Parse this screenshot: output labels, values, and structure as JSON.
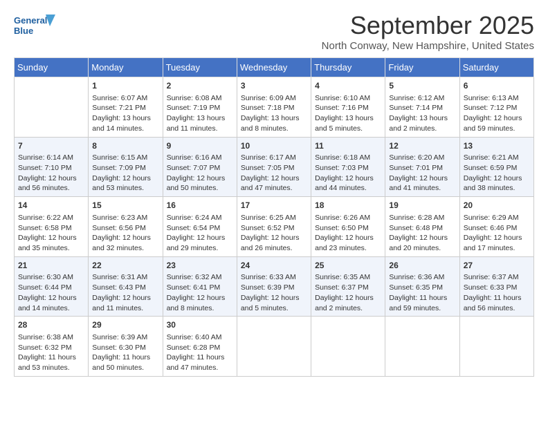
{
  "header": {
    "logo_line1": "General",
    "logo_line2": "Blue",
    "title": "September 2025",
    "subtitle": "North Conway, New Hampshire, United States"
  },
  "days_of_week": [
    "Sunday",
    "Monday",
    "Tuesday",
    "Wednesday",
    "Thursday",
    "Friday",
    "Saturday"
  ],
  "weeks": [
    [
      {
        "day": "",
        "info": ""
      },
      {
        "day": "1",
        "info": "Sunrise: 6:07 AM\nSunset: 7:21 PM\nDaylight: 13 hours\nand 14 minutes."
      },
      {
        "day": "2",
        "info": "Sunrise: 6:08 AM\nSunset: 7:19 PM\nDaylight: 13 hours\nand 11 minutes."
      },
      {
        "day": "3",
        "info": "Sunrise: 6:09 AM\nSunset: 7:18 PM\nDaylight: 13 hours\nand 8 minutes."
      },
      {
        "day": "4",
        "info": "Sunrise: 6:10 AM\nSunset: 7:16 PM\nDaylight: 13 hours\nand 5 minutes."
      },
      {
        "day": "5",
        "info": "Sunrise: 6:12 AM\nSunset: 7:14 PM\nDaylight: 13 hours\nand 2 minutes."
      },
      {
        "day": "6",
        "info": "Sunrise: 6:13 AM\nSunset: 7:12 PM\nDaylight: 12 hours\nand 59 minutes."
      }
    ],
    [
      {
        "day": "7",
        "info": "Sunrise: 6:14 AM\nSunset: 7:10 PM\nDaylight: 12 hours\nand 56 minutes."
      },
      {
        "day": "8",
        "info": "Sunrise: 6:15 AM\nSunset: 7:09 PM\nDaylight: 12 hours\nand 53 minutes."
      },
      {
        "day": "9",
        "info": "Sunrise: 6:16 AM\nSunset: 7:07 PM\nDaylight: 12 hours\nand 50 minutes."
      },
      {
        "day": "10",
        "info": "Sunrise: 6:17 AM\nSunset: 7:05 PM\nDaylight: 12 hours\nand 47 minutes."
      },
      {
        "day": "11",
        "info": "Sunrise: 6:18 AM\nSunset: 7:03 PM\nDaylight: 12 hours\nand 44 minutes."
      },
      {
        "day": "12",
        "info": "Sunrise: 6:20 AM\nSunset: 7:01 PM\nDaylight: 12 hours\nand 41 minutes."
      },
      {
        "day": "13",
        "info": "Sunrise: 6:21 AM\nSunset: 6:59 PM\nDaylight: 12 hours\nand 38 minutes."
      }
    ],
    [
      {
        "day": "14",
        "info": "Sunrise: 6:22 AM\nSunset: 6:58 PM\nDaylight: 12 hours\nand 35 minutes."
      },
      {
        "day": "15",
        "info": "Sunrise: 6:23 AM\nSunset: 6:56 PM\nDaylight: 12 hours\nand 32 minutes."
      },
      {
        "day": "16",
        "info": "Sunrise: 6:24 AM\nSunset: 6:54 PM\nDaylight: 12 hours\nand 29 minutes."
      },
      {
        "day": "17",
        "info": "Sunrise: 6:25 AM\nSunset: 6:52 PM\nDaylight: 12 hours\nand 26 minutes."
      },
      {
        "day": "18",
        "info": "Sunrise: 6:26 AM\nSunset: 6:50 PM\nDaylight: 12 hours\nand 23 minutes."
      },
      {
        "day": "19",
        "info": "Sunrise: 6:28 AM\nSunset: 6:48 PM\nDaylight: 12 hours\nand 20 minutes."
      },
      {
        "day": "20",
        "info": "Sunrise: 6:29 AM\nSunset: 6:46 PM\nDaylight: 12 hours\nand 17 minutes."
      }
    ],
    [
      {
        "day": "21",
        "info": "Sunrise: 6:30 AM\nSunset: 6:44 PM\nDaylight: 12 hours\nand 14 minutes."
      },
      {
        "day": "22",
        "info": "Sunrise: 6:31 AM\nSunset: 6:43 PM\nDaylight: 12 hours\nand 11 minutes."
      },
      {
        "day": "23",
        "info": "Sunrise: 6:32 AM\nSunset: 6:41 PM\nDaylight: 12 hours\nand 8 minutes."
      },
      {
        "day": "24",
        "info": "Sunrise: 6:33 AM\nSunset: 6:39 PM\nDaylight: 12 hours\nand 5 minutes."
      },
      {
        "day": "25",
        "info": "Sunrise: 6:35 AM\nSunset: 6:37 PM\nDaylight: 12 hours\nand 2 minutes."
      },
      {
        "day": "26",
        "info": "Sunrise: 6:36 AM\nSunset: 6:35 PM\nDaylight: 11 hours\nand 59 minutes."
      },
      {
        "day": "27",
        "info": "Sunrise: 6:37 AM\nSunset: 6:33 PM\nDaylight: 11 hours\nand 56 minutes."
      }
    ],
    [
      {
        "day": "28",
        "info": "Sunrise: 6:38 AM\nSunset: 6:32 PM\nDaylight: 11 hours\nand 53 minutes."
      },
      {
        "day": "29",
        "info": "Sunrise: 6:39 AM\nSunset: 6:30 PM\nDaylight: 11 hours\nand 50 minutes."
      },
      {
        "day": "30",
        "info": "Sunrise: 6:40 AM\nSunset: 6:28 PM\nDaylight: 11 hours\nand 47 minutes."
      },
      {
        "day": "",
        "info": ""
      },
      {
        "day": "",
        "info": ""
      },
      {
        "day": "",
        "info": ""
      },
      {
        "day": "",
        "info": ""
      }
    ]
  ]
}
